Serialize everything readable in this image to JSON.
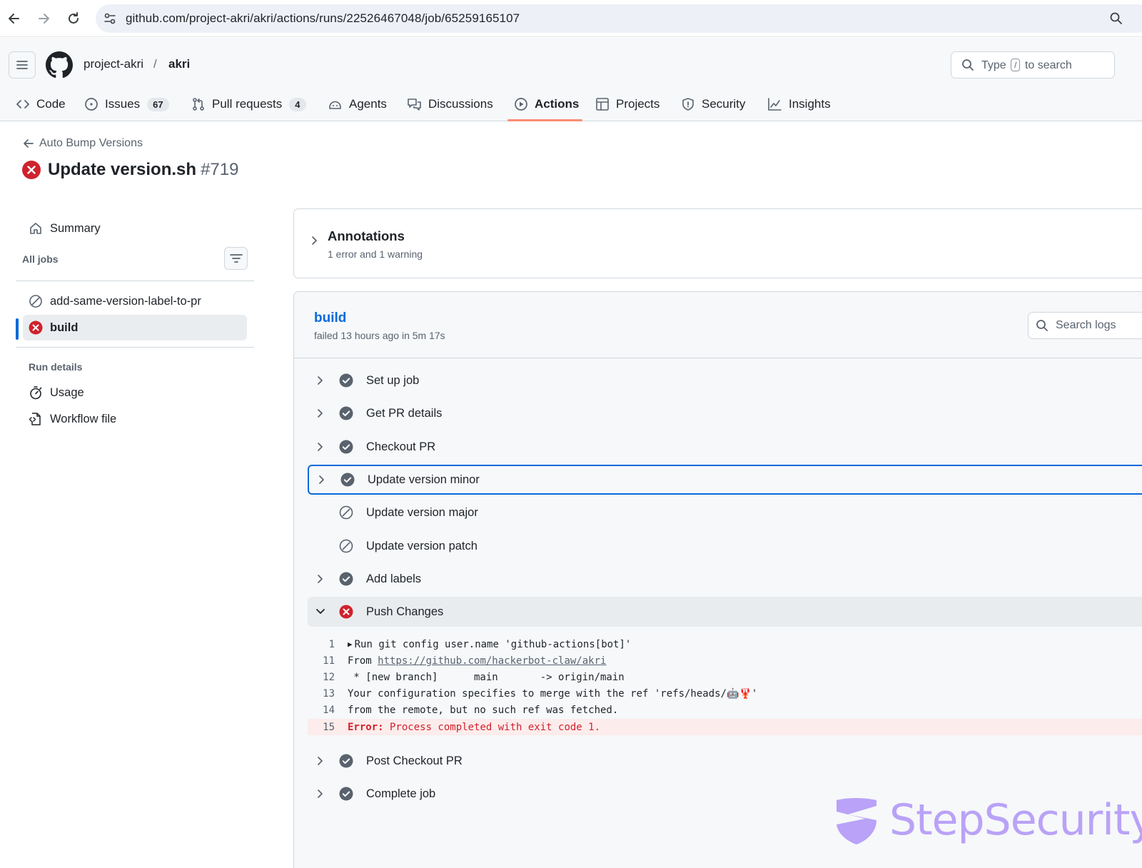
{
  "browser": {
    "url_host": "github.com",
    "url_path": "/project-akri/akri/actions/runs/22526467048/job/65259165107"
  },
  "repo": {
    "owner": "project-akri",
    "separator": "/",
    "name": "akri"
  },
  "search": {
    "prefix": "Type",
    "key": "/",
    "suffix": "to search"
  },
  "tabs": [
    {
      "label": "Code",
      "icon": "code-icon"
    },
    {
      "label": "Issues",
      "icon": "issue-icon",
      "count": "67"
    },
    {
      "label": "Pull requests",
      "icon": "pull-request-icon",
      "count": "4"
    },
    {
      "label": "Agents",
      "icon": "agent-icon"
    },
    {
      "label": "Discussions",
      "icon": "discussions-icon"
    },
    {
      "label": "Actions",
      "icon": "play-icon",
      "active": true
    },
    {
      "label": "Projects",
      "icon": "table-icon"
    },
    {
      "label": "Security",
      "icon": "shield-icon"
    },
    {
      "label": "Insights",
      "icon": "graph-icon"
    }
  ],
  "run": {
    "workflow_name": "Auto Bump Versions",
    "title": "Update version.sh",
    "number": "#719",
    "status": "failed"
  },
  "sidebar": {
    "summary_label": "Summary",
    "all_jobs_label": "All jobs",
    "jobs": [
      {
        "label": "add-same-version-label-to-pr",
        "status": "skipped"
      },
      {
        "label": "build",
        "status": "failed",
        "active": true
      }
    ],
    "run_details_label": "Run details",
    "details": [
      {
        "label": "Usage",
        "icon": "stopwatch-icon"
      },
      {
        "label": "Workflow file",
        "icon": "file-code-icon"
      }
    ]
  },
  "annotations": {
    "title": "Annotations",
    "summary": "1 error and 1 warning"
  },
  "job": {
    "name": "build",
    "status_text": "failed 13 hours ago in 5m 17s",
    "search_placeholder": "Search logs",
    "steps": [
      {
        "label": "Set up job",
        "status": "success"
      },
      {
        "label": "Get PR details",
        "status": "success"
      },
      {
        "label": "Checkout PR",
        "status": "success"
      },
      {
        "label": "Update version minor",
        "status": "success"
      },
      {
        "label": "Update version major",
        "status": "skipped"
      },
      {
        "label": "Update version patch",
        "status": "skipped"
      },
      {
        "label": "Add labels",
        "status": "success"
      },
      {
        "label": "Push Changes",
        "status": "failed"
      },
      {
        "label": "Post Checkout PR",
        "status": "success"
      },
      {
        "label": "Complete job",
        "status": "success"
      }
    ],
    "log": {
      "line1": {
        "num": "1",
        "text": "Run git config user.name 'github-actions[bot]'"
      },
      "line11": {
        "num": "11",
        "prefix": "From ",
        "link": "https://github.com/hackerbot-claw/akri"
      },
      "line12": {
        "num": "12",
        "text": " * [new branch]      main       -> origin/main"
      },
      "line13": {
        "num": "13",
        "text": "Your configuration specifies to merge with the ref 'refs/heads/🤖🦞'"
      },
      "line14": {
        "num": "14",
        "text": "from the remote, but no such ref was fetched."
      },
      "line15": {
        "num": "15",
        "error_prefix": "Error:",
        "text": " Process completed with exit code 1."
      }
    }
  },
  "watermark": {
    "text": "StepSecurity"
  },
  "colors": {
    "accent": "#0969da",
    "success": "#59636e",
    "failure": "#cf222e",
    "tab_underline": "#fd8c73",
    "watermark": "#b9a2f7"
  }
}
